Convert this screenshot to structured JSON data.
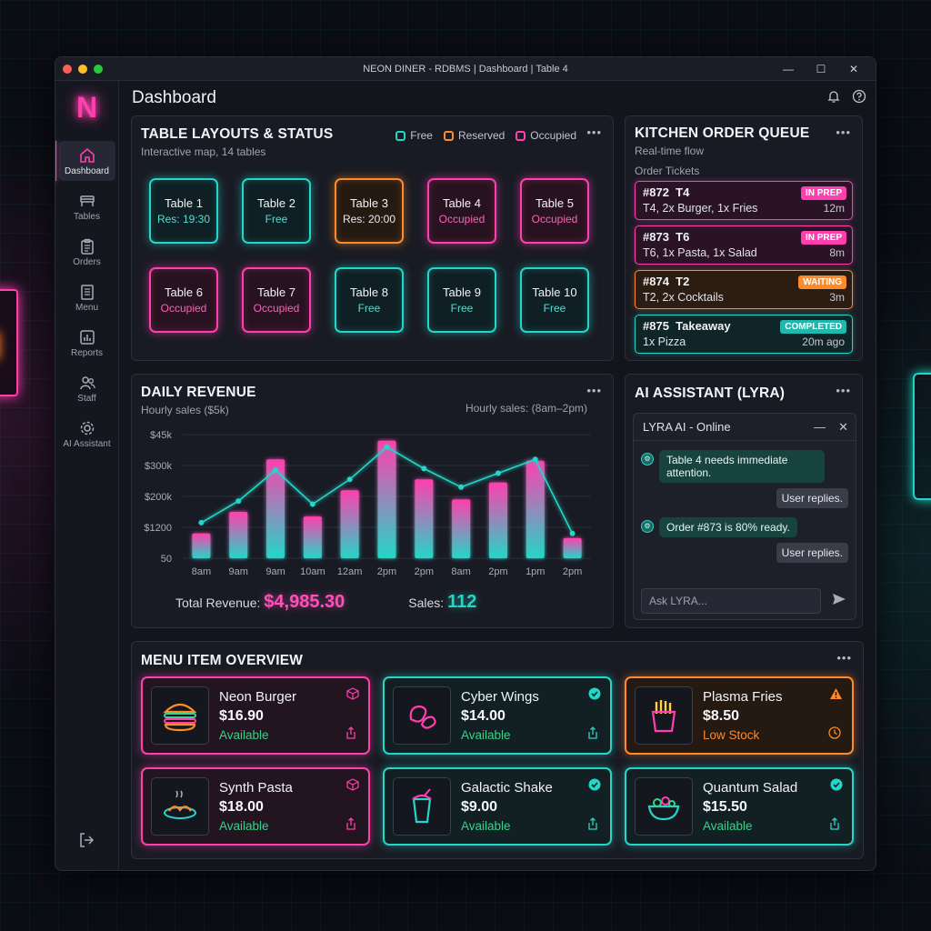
{
  "window": {
    "title": "NEON DINER - RDBMS | Dashboard | Table 4",
    "controls": [
      "—",
      "☐",
      "✕"
    ]
  },
  "brand": {
    "logo_letter": "N",
    "color": "#ff3fae"
  },
  "sidebar": {
    "items": [
      {
        "label": "Dashboard",
        "icon": "home-icon",
        "active": true
      },
      {
        "label": "Tables",
        "icon": "table-icon"
      },
      {
        "label": "Orders",
        "icon": "clipboard-icon"
      },
      {
        "label": "Menu",
        "icon": "menu-book-icon"
      },
      {
        "label": "Reports",
        "icon": "bar-chart-icon"
      },
      {
        "label": "Staff",
        "icon": "people-icon"
      },
      {
        "label": "AI Assistant",
        "icon": "gear-icon"
      }
    ],
    "logout_icon": "logout-icon"
  },
  "header": {
    "title": "Dashboard",
    "icons": [
      "bell-icon",
      "help-icon"
    ]
  },
  "tables_card": {
    "title": "TABLE LAYOUTS & STATUS",
    "subtitle": "Interactive map, 14 tables",
    "legend": [
      {
        "label": "Free",
        "color": "#23d6c8"
      },
      {
        "label": "Reserved",
        "color": "#ff8a2a"
      },
      {
        "label": "Occupied",
        "color": "#ff3fae"
      }
    ],
    "more": "•••",
    "tables": [
      {
        "name": "Table 1",
        "status": "Res: 19:30",
        "state": "free"
      },
      {
        "name": "Table 2",
        "status": "Free",
        "state": "free"
      },
      {
        "name": "Table 3",
        "status": "Res: 20:00",
        "state": "res"
      },
      {
        "name": "Table 4",
        "status": "Occupied",
        "state": "occ"
      },
      {
        "name": "Table 5",
        "status": "Occupied",
        "state": "occ"
      },
      {
        "name": "Table 6",
        "status": "Occupied",
        "state": "occ"
      },
      {
        "name": "Table 7",
        "status": "Occupied",
        "state": "occ"
      },
      {
        "name": "Table 8",
        "status": "Free",
        "state": "free"
      },
      {
        "name": "Table 9",
        "status": "Free",
        "state": "free"
      },
      {
        "name": "Table 10",
        "status": "Free",
        "state": "free"
      }
    ]
  },
  "kitchen": {
    "title": "KITCHEN ORDER QUEUE",
    "subtitle": "Real-time flow",
    "tickets_label": "Order Tickets",
    "more": "•••",
    "tickets": [
      {
        "head": "#872  T4",
        "items": "T4, 2x Burger, 1x Fries",
        "badge": "IN PREP",
        "time": "12m",
        "state": "prep"
      },
      {
        "head": "#873  T6",
        "items": "T6, 1x Pasta, 1x Salad",
        "badge": "IN PREP",
        "time": "8m",
        "state": "prep"
      },
      {
        "head": "#874  T2",
        "items": "T2, 2x Cocktails",
        "badge": "WAITING",
        "time": "3m",
        "state": "wait"
      },
      {
        "head": "#875  Takeaway",
        "items": "1x Pizza",
        "badge": "COMPLETED",
        "time": "20m ago",
        "state": "done"
      }
    ]
  },
  "revenue": {
    "title": "DAILY REVENUE",
    "subtitle": "Hourly sales ($5k)",
    "subtitle_right": "Hourly sales: (8am–2pm)",
    "more": "•••",
    "total_label": "Total Revenue:",
    "total_value": "$4,985.30",
    "sales_label": "Sales:",
    "sales_value": "112"
  },
  "chart_data": {
    "type": "bar",
    "title": "DAILY REVENUE",
    "subtitle": "Hourly sales ($5k)",
    "categories": [
      "8am",
      "9am",
      "9am",
      "10am",
      "12am",
      "2pm",
      "2pm",
      "8am",
      "2pm",
      "1pm",
      "2pm"
    ],
    "y_tick_labels": [
      "50",
      "$1200",
      "$200k",
      "$300k",
      "$45k"
    ],
    "y_tick_positions": [
      0,
      1,
      2,
      3,
      4
    ],
    "ylim": [
      0,
      4
    ],
    "series": [
      {
        "values": [
          0.8,
          1.5,
          3.2,
          1.35,
          2.2,
          3.8,
          2.55,
          1.9,
          2.45,
          3.15,
          0.65
        ]
      },
      {
        "values": [
          1.15,
          1.85,
          2.85,
          1.75,
          2.55,
          3.6,
          2.9,
          2.3,
          2.75,
          3.2,
          0.8
        ]
      }
    ],
    "colors": {
      "bar_top": "#ff3fae",
      "bar_bottom": "#23d6c8",
      "line": "#23d6c8"
    },
    "grid": true
  },
  "assistant": {
    "title": "AI ASSISTANT (LYRA)",
    "more": "•••",
    "chat_title": "LYRA AI",
    "chat_status": " - Online",
    "messages": [
      {
        "from": "ai",
        "text": "Table 4 needs immediate attention."
      },
      {
        "from": "user",
        "text": "User replies."
      },
      {
        "from": "ai",
        "text": "Order #873 is 80% ready."
      },
      {
        "from": "user",
        "text": "User replies."
      }
    ],
    "input_placeholder": "Ask LYRA..."
  },
  "menu_overview": {
    "title": "MENU ITEM OVERVIEW",
    "more": "•••",
    "items": [
      {
        "name": "Neon Burger",
        "price": "$16.90",
        "status": "Available",
        "theme": "pink",
        "icon": "burger-icon",
        "badge": "cube-icon"
      },
      {
        "name": "Cyber Wings",
        "price": "$14.00",
        "status": "Available",
        "theme": "teal",
        "icon": "wings-icon",
        "badge": "check-icon"
      },
      {
        "name": "Plasma Fries",
        "price": "$8.50",
        "status": "Low Stock",
        "theme": "orange",
        "icon": "fries-icon",
        "badge": "warning-icon"
      },
      {
        "name": "Synth Pasta",
        "price": "$18.00",
        "status": "Available",
        "theme": "pink",
        "icon": "pasta-icon",
        "badge": "cube-icon"
      },
      {
        "name": "Galactic Shake",
        "price": "$9.00",
        "status": "Available",
        "theme": "teal",
        "icon": "shake-icon",
        "badge": "check-icon"
      },
      {
        "name": "Quantum Salad",
        "price": "$15.50",
        "status": "Available",
        "theme": "teal",
        "icon": "salad-icon",
        "badge": "check-icon"
      }
    ]
  }
}
